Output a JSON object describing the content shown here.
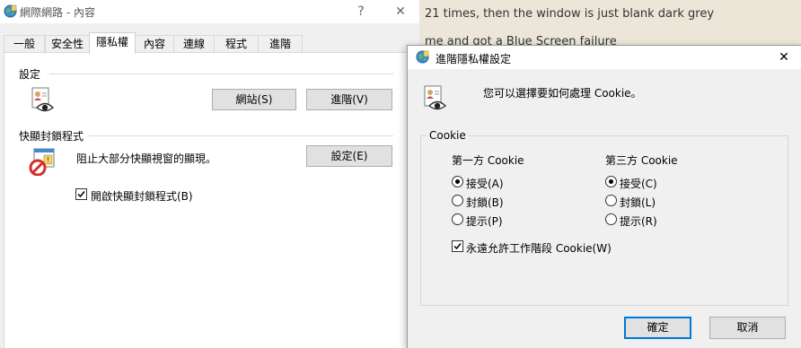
{
  "background_text": {
    "line1": "21 times, then the window is just blank dark grey",
    "line2": "me and got a Blue Screen failure"
  },
  "main_dialog": {
    "title": "網際網路 - 內容",
    "help_glyph": "?",
    "close_glyph": "✕",
    "tabs": [
      "一般",
      "安全性",
      "隱私權",
      "內容",
      "連線",
      "程式",
      "進階"
    ],
    "active_tab": "隱私權",
    "settings_section": {
      "label": "設定",
      "sites_button": "網站(S)",
      "advanced_button": "進階(V)"
    },
    "popup_section": {
      "label": "快顯封鎖程式",
      "description": "阻止大部分快顯視窗的顯現。",
      "settings_button": "設定(E)",
      "enable_checkbox_label": "開啟快顯封鎖程式(B)",
      "enable_checked": true
    }
  },
  "advanced_dialog": {
    "title": "進階隱私權設定",
    "close_glyph": "✕",
    "intro": "您可以選擇要如何處理 Cookie。",
    "group_label": "Cookie",
    "first_party": {
      "header": "第一方 Cookie",
      "options": [
        "接受(A)",
        "封鎖(B)",
        "提示(P)"
      ],
      "selected": "接受(A)"
    },
    "third_party": {
      "header": "第三方 Cookie",
      "options": [
        "接受(C)",
        "封鎖(L)",
        "提示(R)"
      ],
      "selected": "接受(C)"
    },
    "session_cookie_label": "永遠允許工作階段 Cookie(W)",
    "session_cookie_checked": true,
    "ok_button": "確定",
    "cancel_button": "取消"
  },
  "colors": {
    "accent_focus": "#0078d7",
    "background_page": "#ece6d9"
  },
  "icons": [
    "internet-options-icon",
    "privacy-person-eye-icon",
    "popup-blocker-icon",
    "checkmark-icon"
  ]
}
